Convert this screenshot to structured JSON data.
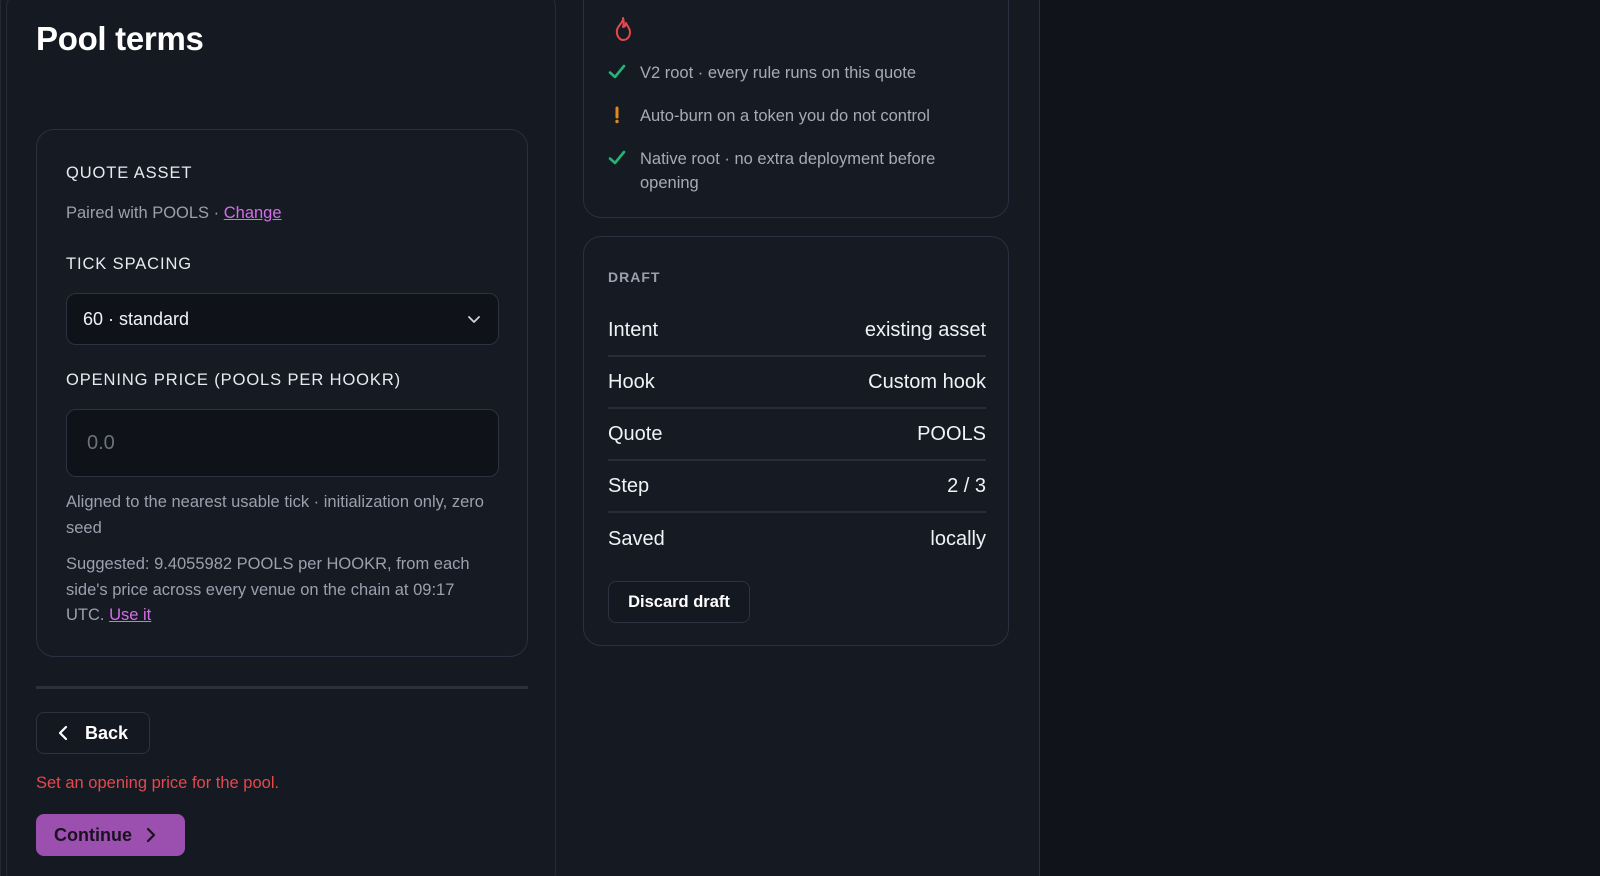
{
  "page": {
    "title": "Pool terms"
  },
  "quote_asset": {
    "label": "QUOTE ASSET",
    "paired_text": "Paired with POOLS ·",
    "change_link": "Change"
  },
  "tick_spacing": {
    "label": "TICK SPACING",
    "selected": "60 · standard"
  },
  "opening_price": {
    "label": "OPENING PRICE (POOLS PER HOOKR)",
    "placeholder": "0.0",
    "value": "",
    "help": "Aligned to the nearest usable tick · initialization only, zero seed",
    "suggestion": "Suggested: 9.4055982 POOLS per HOOKR, from each side's price across every venue on the chain at 09:17 UTC.",
    "use_link": "Use it"
  },
  "actions": {
    "back_label": "Back",
    "error": "Set an opening price for the pool.",
    "continue_label": "Continue"
  },
  "checks": {
    "icon": "flame-icon",
    "items": [
      {
        "status": "ok",
        "icon": "check-icon",
        "text": "V2 root · every rule runs on this quote"
      },
      {
        "status": "warn",
        "icon": "exclamation-icon",
        "text": "Auto-burn on a token you do not control"
      },
      {
        "status": "ok",
        "icon": "check-icon",
        "text": "Native root · no extra deployment before opening"
      }
    ]
  },
  "draft": {
    "label": "DRAFT",
    "rows": [
      {
        "key": "Intent",
        "value": "existing asset"
      },
      {
        "key": "Hook",
        "value": "Custom hook"
      },
      {
        "key": "Quote",
        "value": "POOLS"
      },
      {
        "key": "Step",
        "value": "2 / 3"
      },
      {
        "key": "Saved",
        "value": "locally"
      }
    ],
    "discard_label": "Discard draft"
  },
  "colors": {
    "accent": "#9b4fae",
    "link": "#d36ee8",
    "success": "#22b573",
    "warning": "#e08a1e",
    "danger": "#e5484d"
  }
}
